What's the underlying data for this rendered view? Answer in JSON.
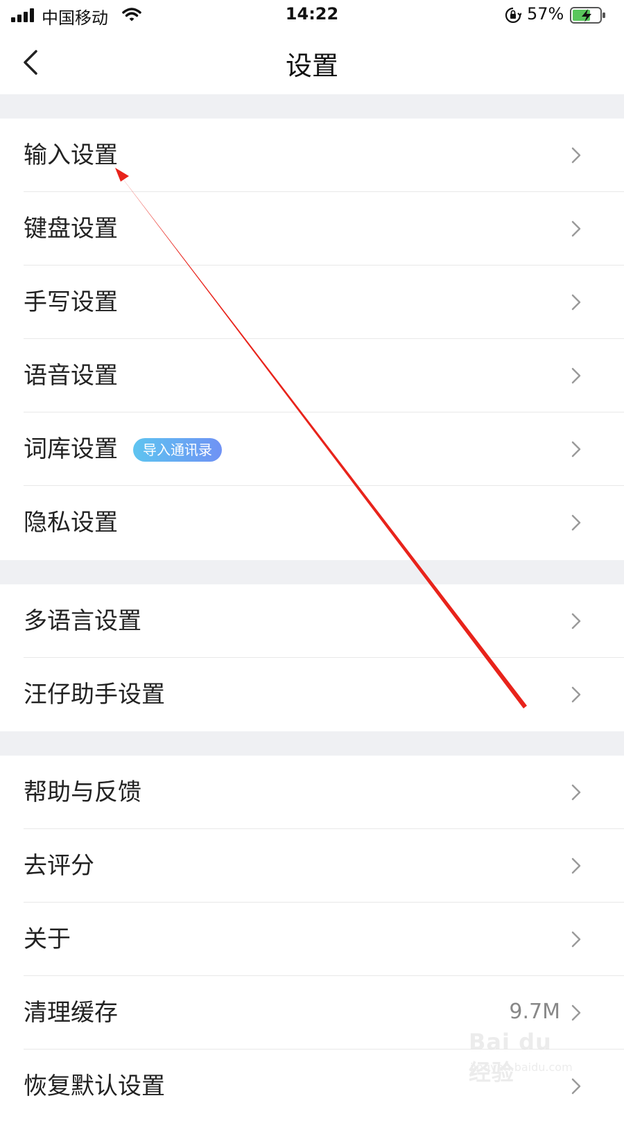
{
  "status_bar": {
    "carrier": "中国移动",
    "time": "14:22",
    "battery_percent": "57%",
    "icons": [
      "signal-icon",
      "wifi-icon",
      "orientation-lock-icon",
      "battery-charging-icon"
    ]
  },
  "nav": {
    "title": "设置",
    "back_icon": "chevron-left-icon"
  },
  "groups": [
    {
      "items": [
        {
          "label": "输入设置"
        },
        {
          "label": "键盘设置"
        },
        {
          "label": "手写设置"
        },
        {
          "label": "语音设置"
        },
        {
          "label": "词库设置",
          "badge": "导入通讯录"
        },
        {
          "label": "隐私设置"
        }
      ]
    },
    {
      "items": [
        {
          "label": "多语言设置"
        },
        {
          "label": "汪仔助手设置"
        }
      ]
    },
    {
      "items": [
        {
          "label": "帮助与反馈"
        },
        {
          "label": "去评分"
        },
        {
          "label": "关于"
        },
        {
          "label": "清理缓存",
          "value": "9.7M"
        },
        {
          "label": "恢复默认设置"
        }
      ]
    }
  ],
  "colors": {
    "background": "#ffffff",
    "group_gap": "#eff0f3",
    "annotation_arrow": "#e8231b",
    "badge_gradient_start": "#5ec4f0",
    "badge_gradient_end": "#6f92f4"
  },
  "watermark": {
    "main": "Bai du 经验",
    "sub": "jingyan.baidu.com"
  }
}
